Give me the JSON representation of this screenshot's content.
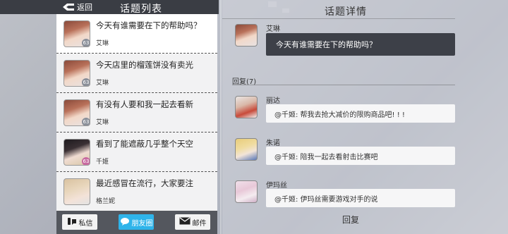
{
  "header": {
    "back_label": "返回",
    "list_title": "话题列表"
  },
  "topics": [
    {
      "text": "今天有谁需要在下的帮助吗？",
      "author": "艾琳",
      "badge": "63"
    },
    {
      "text": "今天店里的榴莲饼没有卖光",
      "author": "艾琳",
      "badge": "63"
    },
    {
      "text": "有没有人要和我一起去看新",
      "author": "艾琳",
      "badge": "63"
    },
    {
      "text": "看到了能遮蔽几乎整个天空",
      "author": "千姬",
      "badge": "63"
    },
    {
      "text": "最近感冒在流行，大家要注",
      "author": "格兰妮",
      "badge": ""
    }
  ],
  "bottom": {
    "message_label": "私信",
    "friends_label": "朋友圈",
    "mail_label": "邮件"
  },
  "detail": {
    "title": "话题详情",
    "poster_name": "艾琳",
    "poster_text": "今天有谁需要在下的帮助吗？",
    "reply_count_label": "回复(7)",
    "replies": [
      {
        "name": "丽达",
        "text": "@千姬: 帮我去抢大减价的限购商品吧! ! !"
      },
      {
        "name": "朱诺",
        "text": "@千姬: 陪我一起去看射击比赛吧"
      },
      {
        "name": "伊玛丝",
        "text": "@千姬: 伊玛丝需要游戏对手的说"
      }
    ],
    "reply_button": "回复"
  },
  "colors": {
    "topbar": "#3a3d44",
    "accent": "#2fb4ea",
    "bubble_dark": "#3d4048"
  }
}
